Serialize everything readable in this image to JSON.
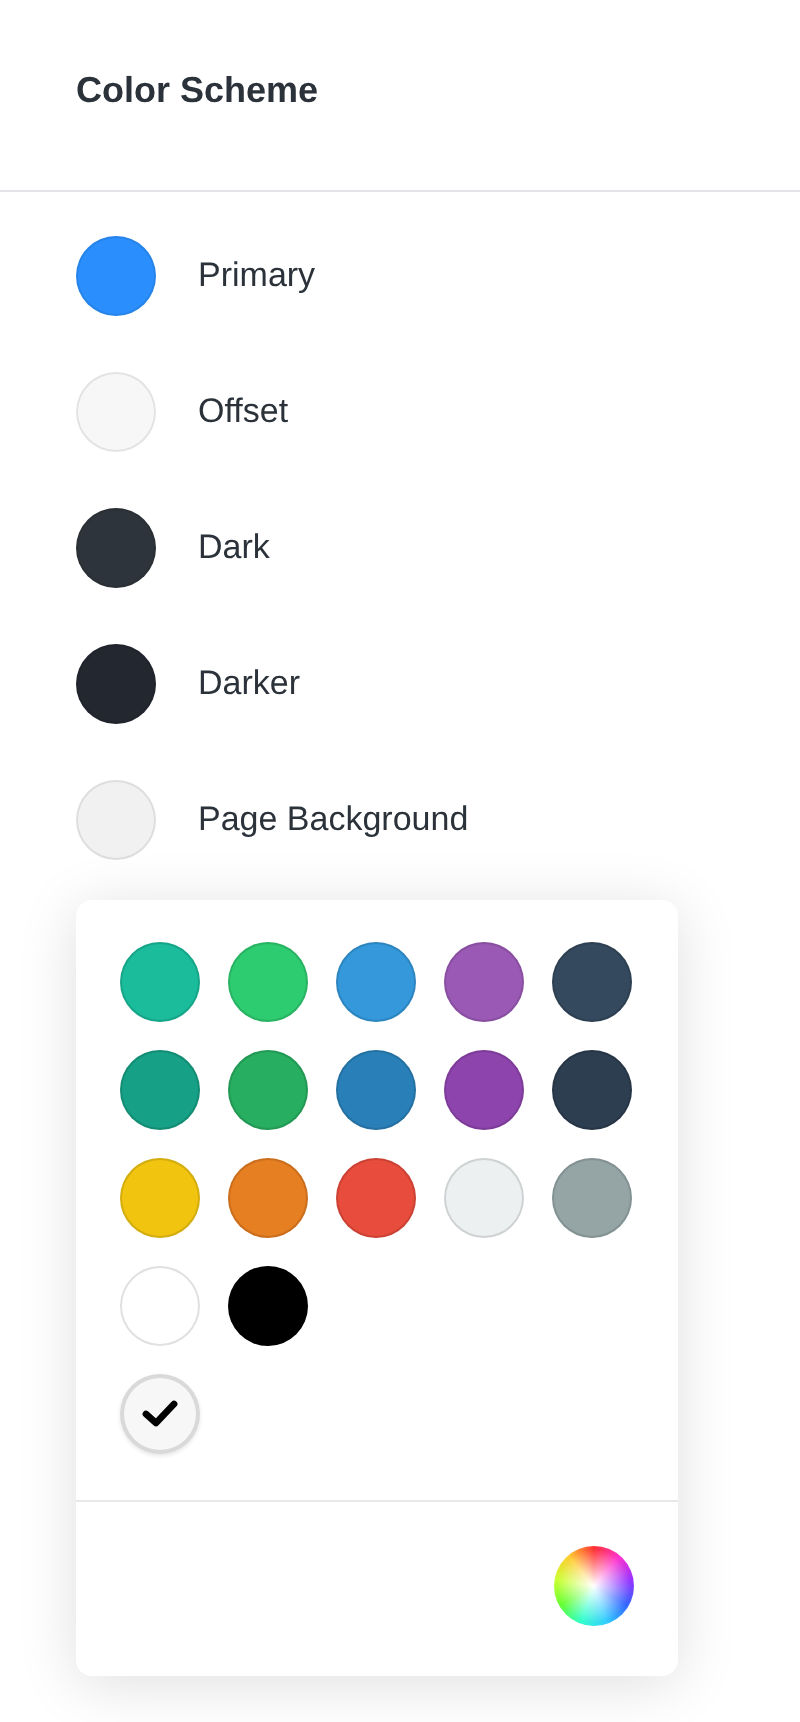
{
  "header": {
    "title": "Color Scheme"
  },
  "scheme_items": [
    {
      "label": "Primary",
      "color": "#2a8ffd"
    },
    {
      "label": "Offset",
      "color": "#f7f7f7"
    },
    {
      "label": "Dark",
      "color": "#2e343b"
    },
    {
      "label": "Darker",
      "color": "#23272f"
    },
    {
      "label": "Page Background",
      "color": "#f1f1f1"
    }
  ],
  "color_picker": {
    "swatches": [
      {
        "color": "#1abc9c",
        "selected": false
      },
      {
        "color": "#2ecc71",
        "selected": false
      },
      {
        "color": "#3498db",
        "selected": false
      },
      {
        "color": "#9b59b6",
        "selected": false
      },
      {
        "color": "#34495e",
        "selected": false
      },
      {
        "color": "#16a085",
        "selected": false
      },
      {
        "color": "#27ae60",
        "selected": false
      },
      {
        "color": "#2980b9",
        "selected": false
      },
      {
        "color": "#8e44ad",
        "selected": false
      },
      {
        "color": "#2c3e50",
        "selected": false
      },
      {
        "color": "#f1c40f",
        "selected": false
      },
      {
        "color": "#e67e22",
        "selected": false
      },
      {
        "color": "#e74c3c",
        "selected": false
      },
      {
        "color": "#ecf0f1",
        "selected": false
      },
      {
        "color": "#95a5a6",
        "selected": false
      },
      {
        "color": "#ffffff",
        "selected": false
      },
      {
        "color": "#000000",
        "selected": false
      },
      {
        "color": "#f7f7f7",
        "selected": true,
        "kind": "custom"
      }
    ]
  }
}
